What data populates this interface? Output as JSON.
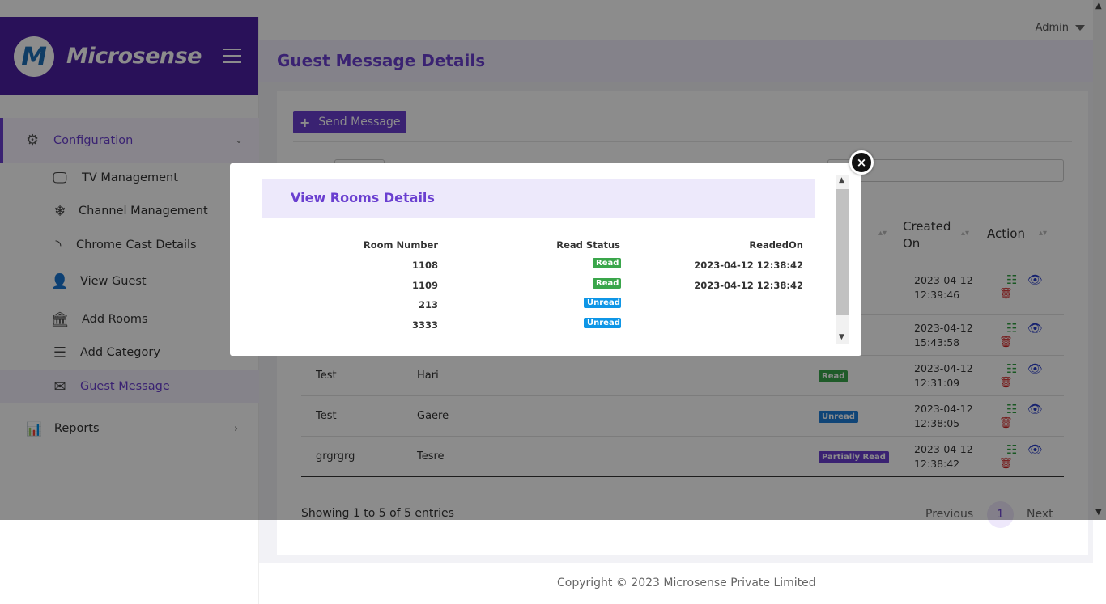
{
  "brand": {
    "logo_letter": "M",
    "name": "Microsense"
  },
  "sidebar": {
    "config_label": "Configuration",
    "items": [
      {
        "label": "TV Management",
        "icon": "monitor-icon"
      },
      {
        "label": "Channel Management",
        "icon": "snowflake-icon"
      },
      {
        "label": "Chrome Cast Details",
        "icon": "rss-icon"
      },
      {
        "label": "View Guest",
        "icon": "user-icon"
      },
      {
        "label": "Add Rooms",
        "icon": "bank-icon"
      },
      {
        "label": "Add Category",
        "icon": "list-card-icon"
      },
      {
        "label": "Guest Message",
        "icon": "envelope-icon"
      }
    ],
    "reports_label": "Reports"
  },
  "topbar": {
    "user": "Admin"
  },
  "page": {
    "title": "Guest Message Details"
  },
  "toolbar": {
    "send_label": "Send Message"
  },
  "table": {
    "headers": {
      "created_on": "Created On",
      "action": "Action"
    },
    "rows": [
      {
        "title": "",
        "guest": "",
        "status": "",
        "created": "2023-04-12 12:39:46"
      },
      {
        "title": "",
        "guest": "",
        "status": "",
        "created": "2023-04-12 15:43:58"
      },
      {
        "title": "Test",
        "guest": "Hari",
        "status": "Read",
        "created": "2023-04-12 12:31:09"
      },
      {
        "title": "Test",
        "guest": "Gaere",
        "status": "Unread",
        "created": "2023-04-12 12:38:05"
      },
      {
        "title": "grgrgrg",
        "guest": "Tesre",
        "status": "Partially Read",
        "created": "2023-04-12 12:38:42"
      }
    ],
    "info": "Showing 1 to 5 of 5 entries",
    "pagination": {
      "previous": "Previous",
      "current": "1",
      "next": "Next"
    }
  },
  "footer": {
    "copyright": "Copyright © 2023 Microsense Private Limited"
  },
  "modal": {
    "title": "View Rooms Details",
    "headers": {
      "room": "Room Number",
      "status": "Read Status",
      "readed_on": "ReadedOn"
    },
    "rows": [
      {
        "room": "1108",
        "status": "Read",
        "readed_on": "2023-04-12 12:38:42"
      },
      {
        "room": "1109",
        "status": "Read",
        "readed_on": "2023-04-12 12:38:42"
      },
      {
        "room": "213",
        "status": "Unread",
        "readed_on": ""
      },
      {
        "room": "3333",
        "status": "Unread",
        "readed_on": ""
      }
    ],
    "close_symbol": "×"
  },
  "colors": {
    "brand": "#4b1fa3",
    "accent": "#6a3fd0",
    "read": "#3aa64b",
    "unread": "#1e7fd9",
    "delete": "#d21f1f"
  }
}
